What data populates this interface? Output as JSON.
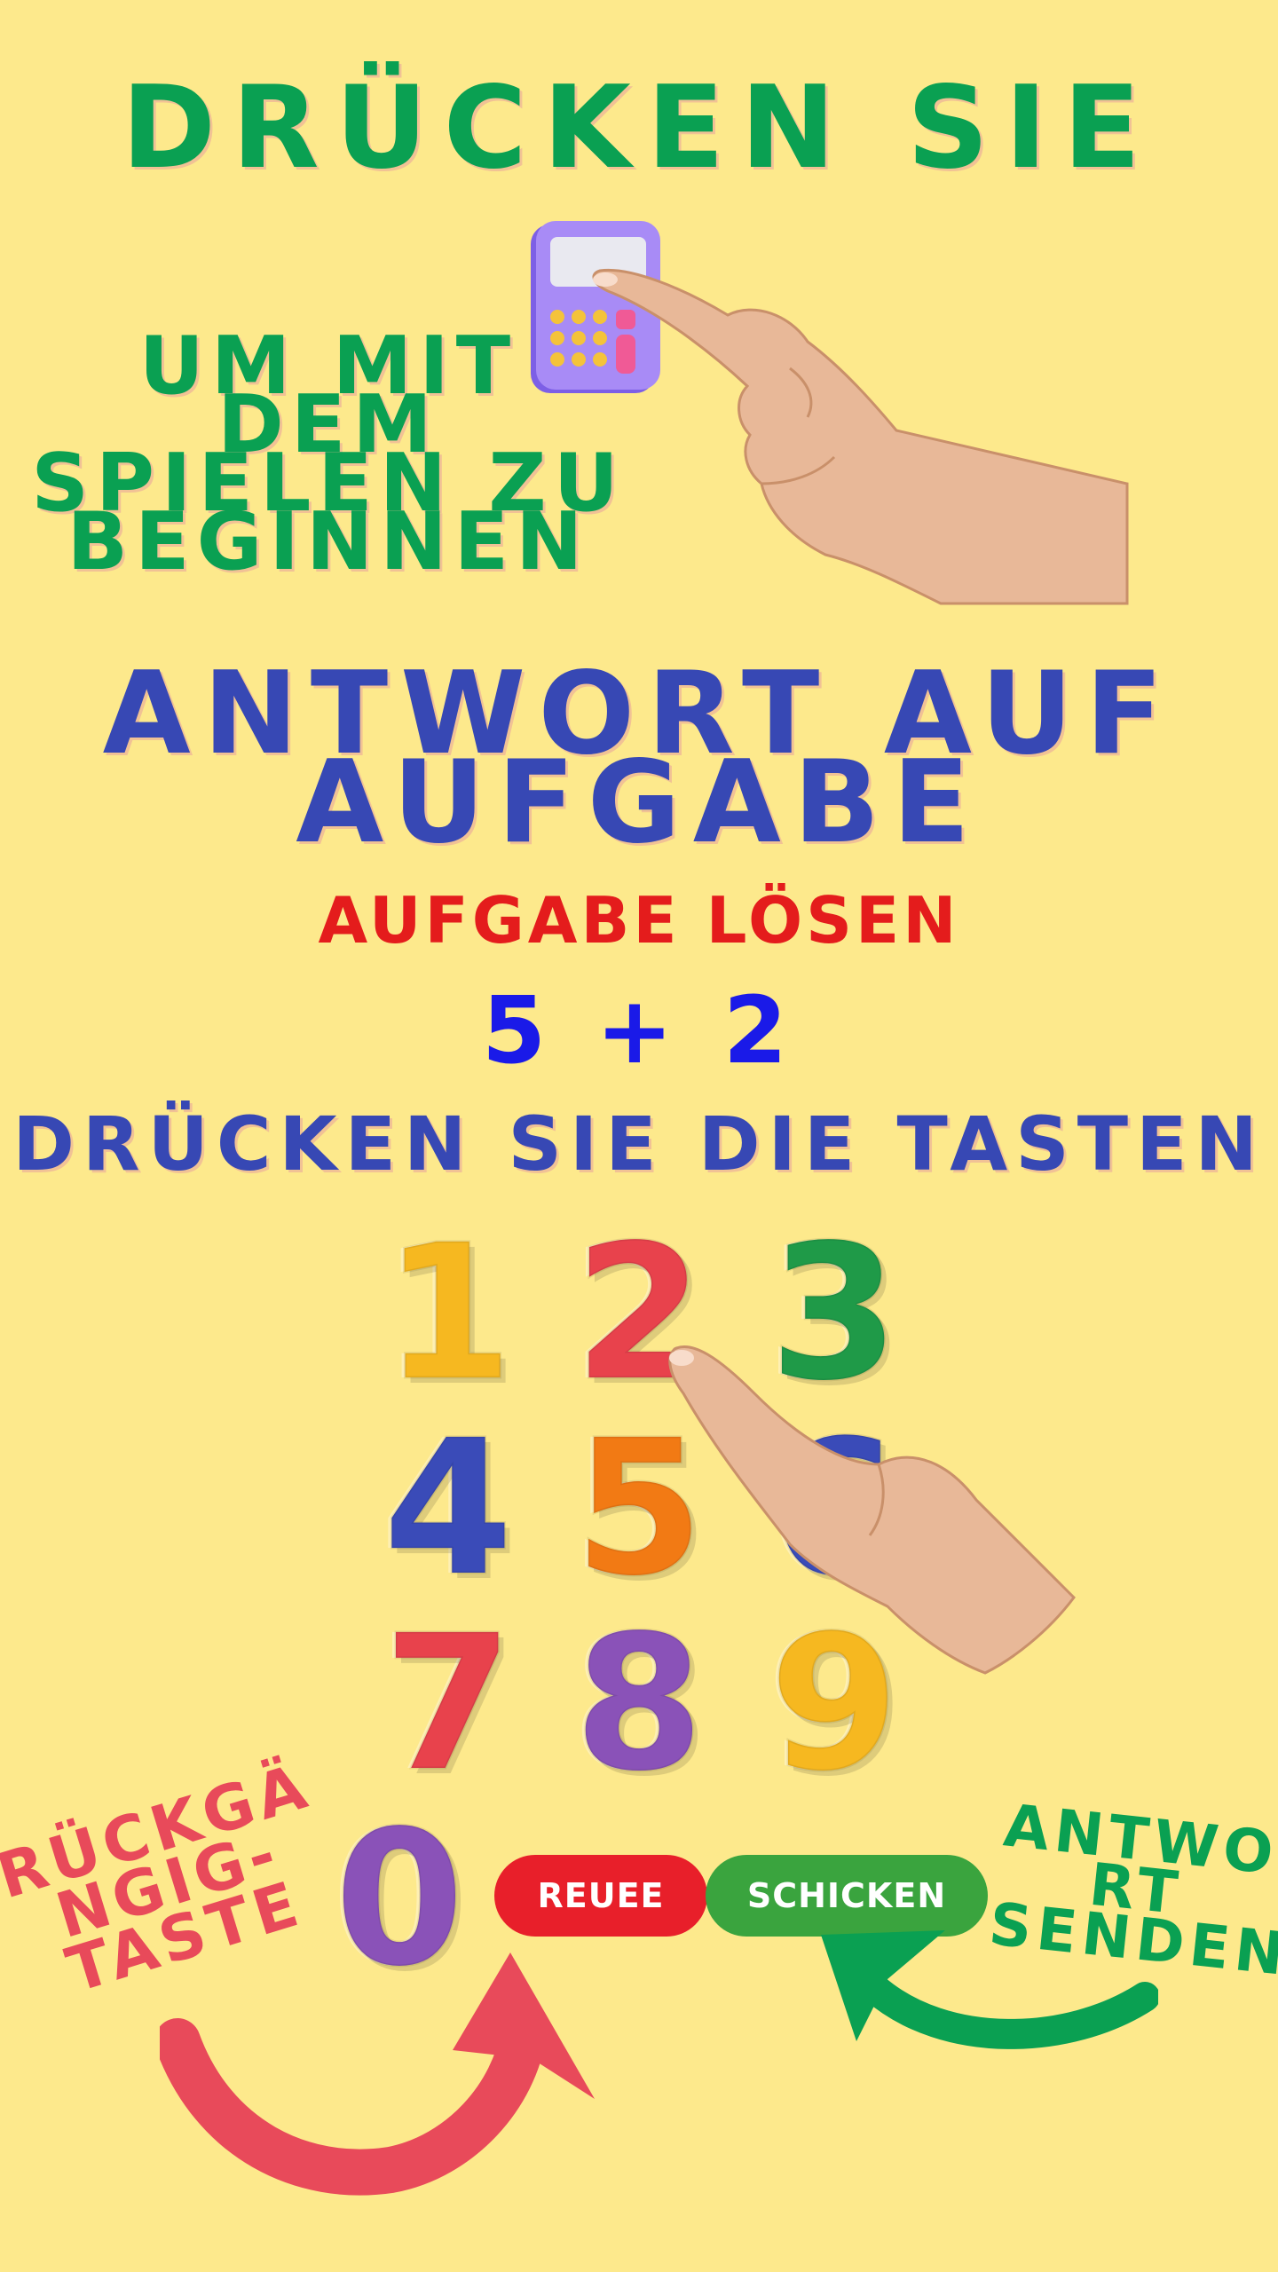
{
  "colors": {
    "background": "#fde98c",
    "green_text": "#0aa052",
    "blue_text": "#3748b4",
    "task_red": "#e41c1c",
    "expression_blue": "#1a1ae8",
    "undo_button": "#e81f2a",
    "send_button": "#3aa43e",
    "backspace_label": "#e84a5a"
  },
  "header": {
    "title": "DRÜCKEN SIE",
    "subtitle_lines": [
      "UM MIT",
      "DEM",
      "SPIELEN ZU",
      "BEGINNEN"
    ]
  },
  "answer_section": {
    "title_lines": [
      "ANTWORT AUF",
      "AUFGABE"
    ],
    "task_label": "AUFGABE LÖSEN",
    "expression": "5 + 2",
    "instruction": "DRÜCKEN SIE DIE TASTEN"
  },
  "keypad": {
    "keys": [
      {
        "label": "1",
        "color": "#f6b820"
      },
      {
        "label": "2",
        "color": "#e8424c"
      },
      {
        "label": "3",
        "color": "#1f9a48"
      },
      {
        "label": "4",
        "color": "#3a4bb8"
      },
      {
        "label": "5",
        "color": "#f27a14"
      },
      {
        "label": "6",
        "color": "#3a4bb8"
      },
      {
        "label": "7",
        "color": "#e8424c"
      },
      {
        "label": "8",
        "color": "#8a52b8"
      },
      {
        "label": "9",
        "color": "#f6b820"
      },
      {
        "label": "0",
        "color": "#8a52b8"
      }
    ]
  },
  "buttons": {
    "undo_label": "REUEE",
    "send_label": "SCHICKEN"
  },
  "annotations": {
    "backspace_lines": [
      "RÜCKGÄ",
      "NGIG-",
      "TASTE"
    ],
    "send_answer_lines": [
      "ANTWO",
      "RT",
      "SENDEN"
    ]
  },
  "icons": {
    "calculator": "calculator-icon",
    "pointing_hand": "pointing-hand-icon",
    "arrow_left": "curved-arrow-icon",
    "arrow_right": "curved-arrow-icon"
  }
}
